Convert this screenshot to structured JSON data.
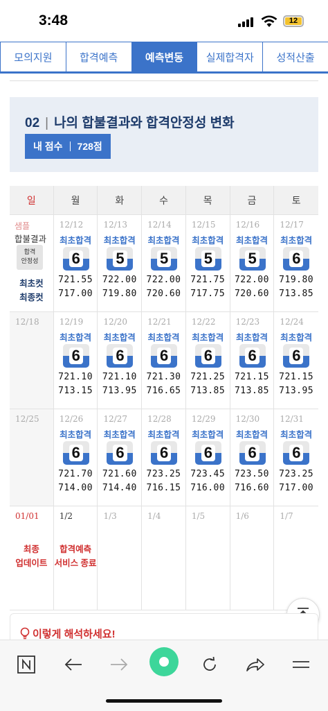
{
  "status": {
    "time": "3:48",
    "battery": "12"
  },
  "tabs": [
    "모의지원",
    "합격예측",
    "예측변동",
    "실제합격자",
    "성적산출"
  ],
  "header": {
    "num": "02",
    "title": "나의 합불결과와 합격안정성 변화",
    "score_label": "내 점수",
    "score": "728점"
  },
  "weekdays": [
    "일",
    "월",
    "화",
    "수",
    "목",
    "금",
    "토"
  ],
  "legend": {
    "sample": "샘플",
    "label": "합불결과",
    "box": "합격\n안정성",
    "cut1": "최초컷",
    "cut2": "최종컷"
  },
  "weeks": [
    [
      {
        "date": "12/12",
        "res": "최초합격",
        "grade": "6",
        "s1": "721.55",
        "s2": "717.00"
      },
      {
        "date": "12/13",
        "res": "최초합격",
        "grade": "5",
        "s1": "722.00",
        "s2": "719.80"
      },
      {
        "date": "12/14",
        "res": "최초합격",
        "grade": "5",
        "s1": "722.00",
        "s2": "720.60"
      },
      {
        "date": "12/15",
        "res": "최초합격",
        "grade": "5",
        "s1": "721.75",
        "s2": "717.75"
      },
      {
        "date": "12/16",
        "res": "최초합격",
        "grade": "5",
        "s1": "722.00",
        "s2": "720.60"
      },
      {
        "date": "12/17",
        "res": "최초합격",
        "grade": "6",
        "s1": "719.80",
        "s2": "713.85"
      }
    ],
    [
      {
        "date": "12/19",
        "res": "최초합격",
        "grade": "6",
        "s1": "721.10",
        "s2": "713.15"
      },
      {
        "date": "12/20",
        "res": "최초합격",
        "grade": "6",
        "s1": "721.10",
        "s2": "713.95"
      },
      {
        "date": "12/21",
        "res": "최초합격",
        "grade": "6",
        "s1": "721.30",
        "s2": "716.65"
      },
      {
        "date": "12/22",
        "res": "최초합격",
        "grade": "6",
        "s1": "721.25",
        "s2": "713.85"
      },
      {
        "date": "12/23",
        "res": "최초합격",
        "grade": "6",
        "s1": "721.15",
        "s2": "713.85"
      },
      {
        "date": "12/24",
        "res": "최초합격",
        "grade": "6",
        "s1": "721.15",
        "s2": "713.95"
      }
    ],
    [
      {
        "date": "12/26",
        "res": "최초합격",
        "grade": "6",
        "s1": "721.70",
        "s2": "714.00"
      },
      {
        "date": "12/27",
        "res": "최초합격",
        "grade": "6",
        "s1": "721.60",
        "s2": "714.40"
      },
      {
        "date": "12/28",
        "res": "최초합격",
        "grade": "6",
        "s1": "723.25",
        "s2": "716.15"
      },
      {
        "date": "12/29",
        "res": "최초합격",
        "grade": "6",
        "s1": "723.45",
        "s2": "716.00"
      },
      {
        "date": "12/30",
        "res": "최초합격",
        "grade": "6",
        "s1": "723.50",
        "s2": "716.60"
      },
      {
        "date": "12/31",
        "res": "최초합격",
        "grade": "6",
        "s1": "723.25",
        "s2": "717.00"
      }
    ]
  ],
  "sundays": [
    "12/18",
    "12/25"
  ],
  "lastweek": {
    "sun": "01/01",
    "sun_text": "최종\n업데이트",
    "mon": "1/2",
    "mon_text": "합격예측\n서비스 종료",
    "rest": [
      "1/3",
      "1/4",
      "1/5",
      "1/6",
      "1/7"
    ]
  },
  "tip": "이렇게 해석하세요!"
}
